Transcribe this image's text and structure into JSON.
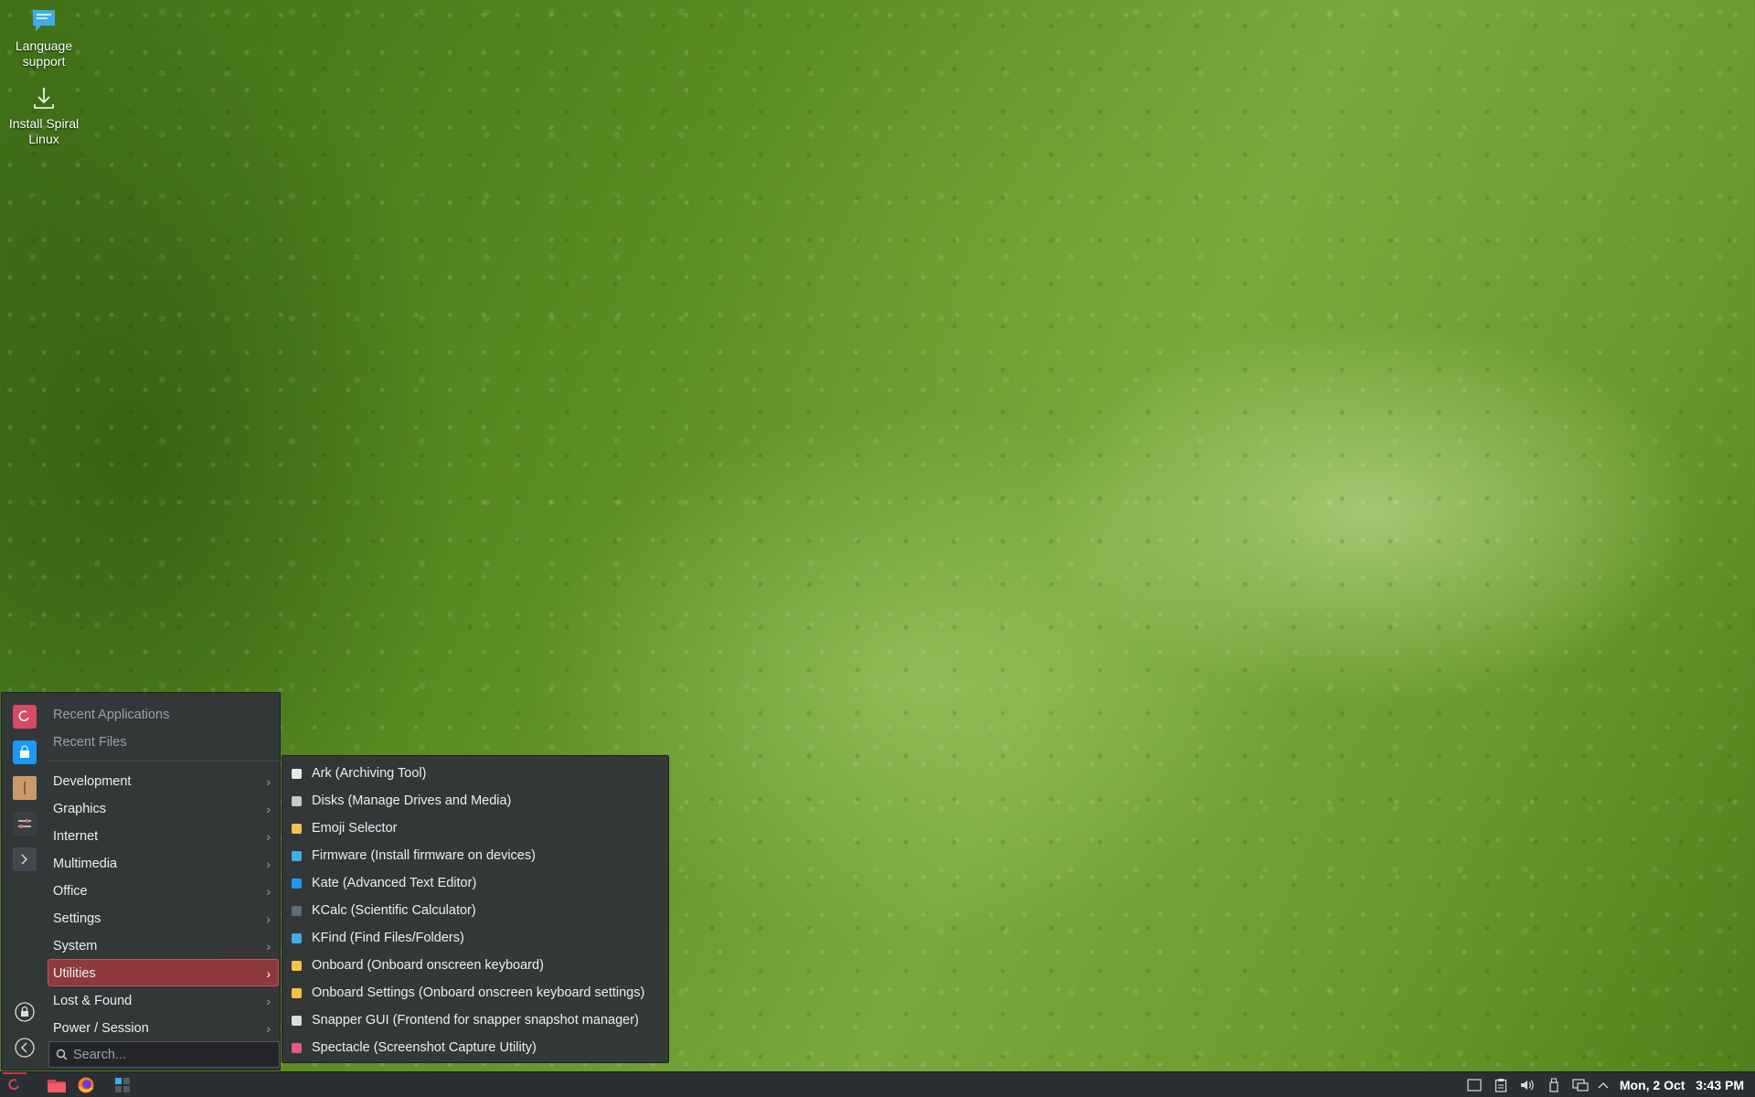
{
  "desktop": {
    "icons": [
      {
        "label": "Language\nsupport",
        "icon": "chat-bubble-icon"
      },
      {
        "label": "Install Spiral\nLinux",
        "icon": "download-icon"
      }
    ]
  },
  "start_menu": {
    "rail": [
      "debian-swirl-icon",
      "store-bag-icon",
      "package-box-icon",
      "sliders-icon",
      "terminal-icon",
      "lock-icon",
      "back-arrow-icon"
    ],
    "top_items": [
      {
        "label": "Recent Applications"
      },
      {
        "label": "Recent Files"
      }
    ],
    "categories": [
      {
        "label": "Development"
      },
      {
        "label": "Graphics"
      },
      {
        "label": "Internet"
      },
      {
        "label": "Multimedia"
      },
      {
        "label": "Office"
      },
      {
        "label": "Settings"
      },
      {
        "label": "System"
      },
      {
        "label": "Utilities"
      },
      {
        "label": "Lost & Found"
      },
      {
        "label": "Power / Session"
      }
    ],
    "selected_category": "Utilities",
    "search": {
      "placeholder": "Search..."
    }
  },
  "utilities_submenu": {
    "items": [
      {
        "label": "Ark (Archiving Tool)",
        "icon": "archive-icon",
        "color": "#e8e8e8"
      },
      {
        "label": "Disks (Manage Drives and Media)",
        "icon": "disk-icon",
        "color": "#c9c9c9"
      },
      {
        "label": "Emoji Selector",
        "icon": "emoji-icon",
        "color": "#f2c14e"
      },
      {
        "label": "Firmware (Install firmware on devices)",
        "icon": "chip-icon",
        "color": "#3daee9"
      },
      {
        "label": "Kate (Advanced Text Editor)",
        "icon": "kate-icon",
        "color": "#1d99f3"
      },
      {
        "label": "KCalc (Scientific Calculator)",
        "icon": "calculator-icon",
        "color": "#5d6d7e"
      },
      {
        "label": "KFind (Find Files/Folders)",
        "icon": "find-file-icon",
        "color": "#3daee9"
      },
      {
        "label": "Onboard (Onboard onscreen keyboard)",
        "icon": "keyboard-icon",
        "color": "#f4c542"
      },
      {
        "label": "Onboard Settings (Onboard onscreen keyboard settings)",
        "icon": "keyboard-settings-icon",
        "color": "#f4c542"
      },
      {
        "label": "Snapper GUI (Frontend for snapper snapshot manager)",
        "icon": "snapshot-icon",
        "color": "#dddddd"
      },
      {
        "label": "Spectacle (Screenshot Capture Utility)",
        "icon": "screenshot-icon",
        "color": "#e05a8a"
      }
    ]
  },
  "taskbar": {
    "launchers": [
      "application-launcher-icon",
      "file-manager-icon",
      "firefox-icon",
      "pager-icon"
    ],
    "tray": [
      "window-icon",
      "clipboard-icon",
      "volume-icon",
      "usb-device-icon",
      "network-icon",
      "expand-tray-icon"
    ],
    "clock": {
      "date": "Mon, 2 Oct",
      "time": "3:43 PM"
    }
  }
}
